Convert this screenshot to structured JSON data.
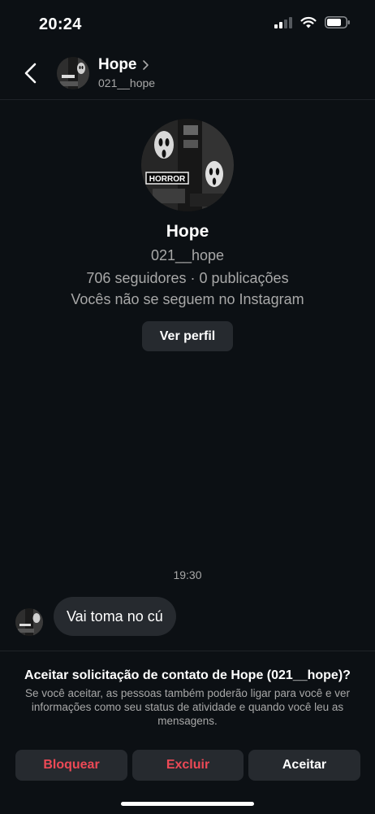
{
  "status_bar": {
    "time": "20:24"
  },
  "header": {
    "name": "Hope",
    "username": "021__hope"
  },
  "profile": {
    "name": "Hope",
    "username": "021__hope",
    "stats": "706 seguidores · 0 publicações",
    "follow_status": "Vocês não se seguem no Instagram",
    "view_profile_label": "Ver perfil",
    "avatar_text": "HORROR"
  },
  "thread": {
    "timestamp": "19:30",
    "messages": [
      {
        "text": "Vai toma no cú"
      }
    ]
  },
  "request": {
    "title": "Aceitar solicitação de contato de Hope (021__hope)?",
    "description": "Se você aceitar, as pessoas também poderão ligar para você e ver informações como seu status de atividade e quando você leu as mensagens.",
    "block_label": "Bloquear",
    "delete_label": "Excluir",
    "accept_label": "Aceitar"
  },
  "colors": {
    "background": "#0c1014",
    "surface": "#262a2f",
    "danger": "#ed4956",
    "secondary_text": "#a8a8a8"
  },
  "icons": [
    "cellular-signal-icon",
    "wifi-icon",
    "battery-icon",
    "back-arrow-icon",
    "chevron-right-icon"
  ]
}
